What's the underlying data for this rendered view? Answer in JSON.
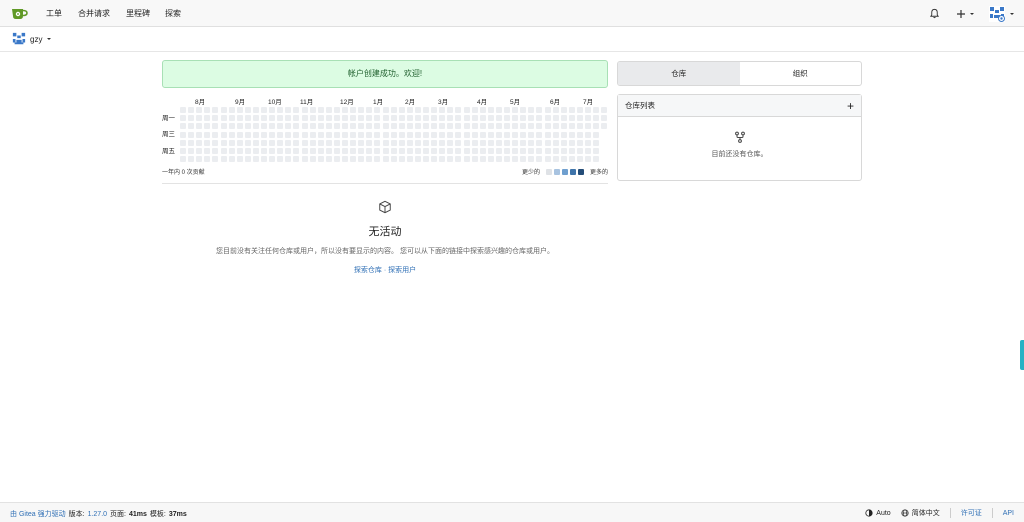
{
  "nav": {
    "items": [
      "工单",
      "合并请求",
      "里程碑",
      "探索"
    ]
  },
  "context": {
    "user": "gzy"
  },
  "flash": {
    "message": "帐户创建成功。欢迎!"
  },
  "heatmap": {
    "months": [
      "8月",
      "9月",
      "10月",
      "11月",
      "12月",
      "1月",
      "2月",
      "3月",
      "4月",
      "5月",
      "6月",
      "7月"
    ],
    "weekdays": [
      "周一",
      "周三",
      "周五"
    ],
    "summary": "一年内 0 次贡献",
    "legend_less": "更少的",
    "legend_more": "更多的",
    "legend_colors": [
      "#dfe2e6",
      "#a8c3e0",
      "#6f9fcf",
      "#3f74aa",
      "#244d78"
    ],
    "empty_color": "#ebedf0",
    "total_contributions": 0
  },
  "empty": {
    "title": "无活动",
    "desc": "您目前没有关注任何仓库或用户，所以没有要显示的内容。 您可以从下面的链接中探索感兴趣的仓库或用户。",
    "link_repos": "探索仓库",
    "link_sep": " · ",
    "link_users": "探索用户"
  },
  "right": {
    "tab_repos": "仓库",
    "tab_orgs": "组织",
    "repo_list_title": "仓库列表",
    "add": "+",
    "no_repos": "目前还没有仓库。"
  },
  "footer": {
    "powered": "由 Gitea 强力驱动",
    "version_label": "版本:",
    "version": "1.27.0",
    "page_label": "页面:",
    "page_time": "41ms",
    "template_label": "模板:",
    "template_time": "37ms",
    "theme": "Auto",
    "language": "简体中文",
    "license": "许可证",
    "api": "API"
  }
}
